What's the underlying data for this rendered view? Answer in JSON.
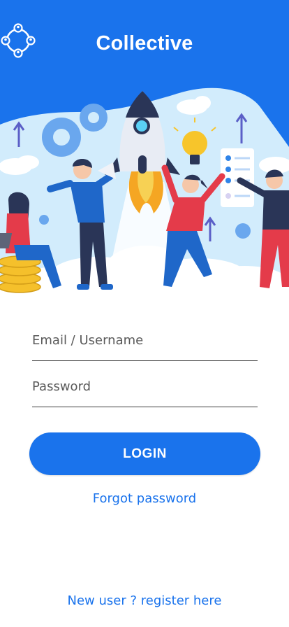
{
  "app": {
    "name": "Collective",
    "logo_icon": "team-network-icon"
  },
  "hero": {
    "illustration": "team-startup-rocket-illustration"
  },
  "form": {
    "email_placeholder": "Email / Username",
    "password_placeholder": "Password",
    "login_label": "LOGIN",
    "forgot_label": "Forgot password",
    "register_label": "New user ? register here"
  },
  "colors": {
    "brand_blue": "#1a73ec",
    "sky_light": "#cfe9fb",
    "text_link": "#1a73ec"
  }
}
